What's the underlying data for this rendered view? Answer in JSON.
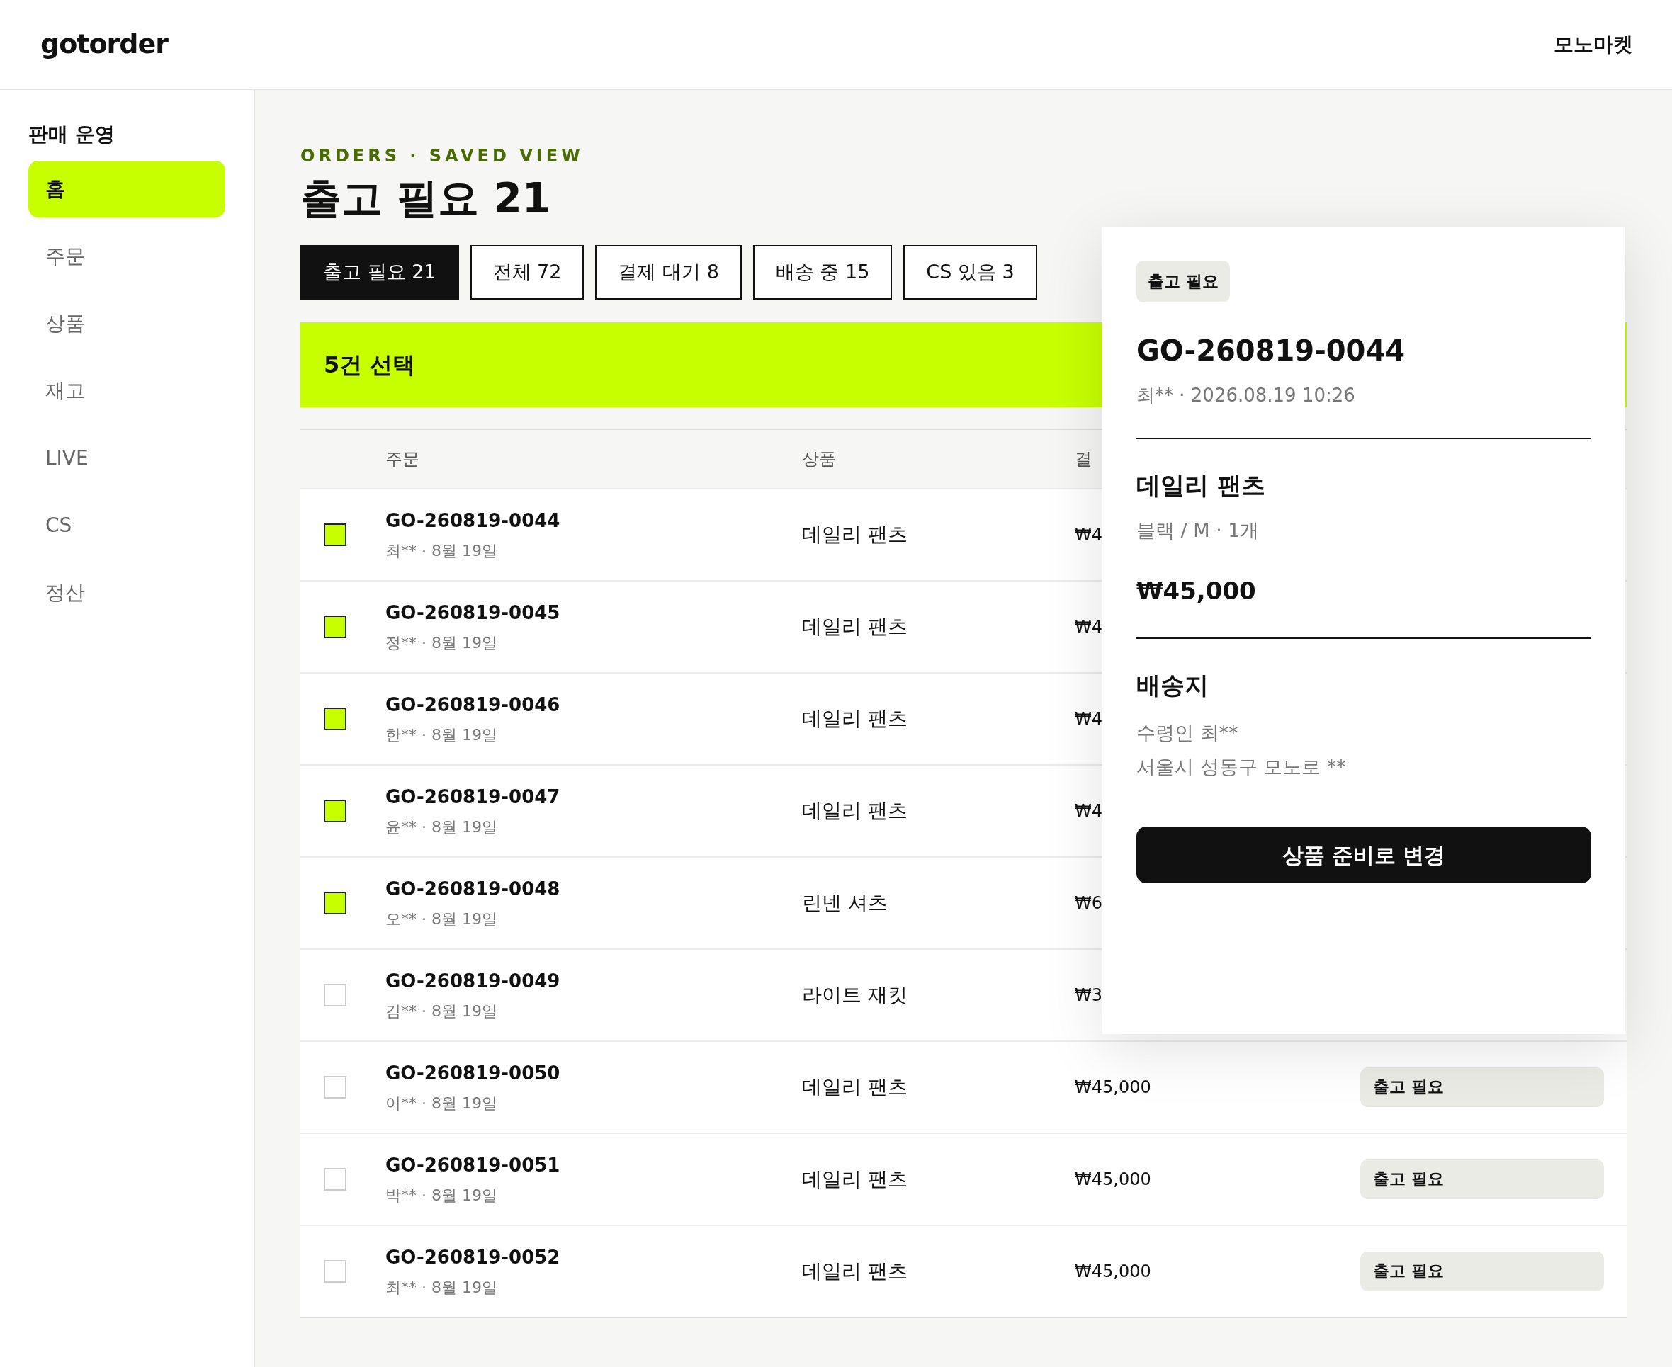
{
  "header": {
    "logo": "gotorder",
    "store": "모노마켓"
  },
  "sidebar": {
    "title": "판매 운영",
    "items": [
      {
        "label": "홈",
        "selected": true
      },
      {
        "label": "주문",
        "selected": false
      },
      {
        "label": "상품",
        "selected": false
      },
      {
        "label": "재고",
        "selected": false
      },
      {
        "label": "LIVE",
        "selected": false
      },
      {
        "label": "CS",
        "selected": false
      },
      {
        "label": "정산",
        "selected": false
      }
    ]
  },
  "eyebrow": "ORDERS · SAVED VIEW",
  "title": "출고 필요 21",
  "tabs": [
    {
      "label": "출고 필요 21",
      "selected": true
    },
    {
      "label": "전체 72",
      "selected": false
    },
    {
      "label": "결제 대기 8",
      "selected": false
    },
    {
      "label": "배송 중 15",
      "selected": false
    },
    {
      "label": "CS 있음 3",
      "selected": false
    }
  ],
  "selection_bar": {
    "text": "5건 선택"
  },
  "table": {
    "columns": [
      "주문",
      "상품",
      "결"
    ],
    "rows": [
      {
        "checked": true,
        "order": "GO-260819-0044",
        "meta": "최** · 8월 19일",
        "product": "데일리 팬츠",
        "price": "₩4"
      },
      {
        "checked": true,
        "order": "GO-260819-0045",
        "meta": "정** · 8월 19일",
        "product": "데일리 팬츠",
        "price": "₩4"
      },
      {
        "checked": true,
        "order": "GO-260819-0046",
        "meta": "한** · 8월 19일",
        "product": "데일리 팬츠",
        "price": "₩4"
      },
      {
        "checked": true,
        "order": "GO-260819-0047",
        "meta": "윤** · 8월 19일",
        "product": "데일리 팬츠",
        "price": "₩4"
      },
      {
        "checked": true,
        "order": "GO-260819-0048",
        "meta": "오** · 8월 19일",
        "product": "린넨 셔츠",
        "price": "₩6"
      },
      {
        "checked": false,
        "order": "GO-260819-0049",
        "meta": "김** · 8월 19일",
        "product": "라이트 재킷",
        "price": "₩3"
      },
      {
        "checked": false,
        "order": "GO-260819-0050",
        "meta": "이** · 8월 19일",
        "product": "데일리 팬츠",
        "price": "₩45,000",
        "status": "출고 필요"
      },
      {
        "checked": false,
        "order": "GO-260819-0051",
        "meta": "박** · 8월 19일",
        "product": "데일리 팬츠",
        "price": "₩45,000",
        "status": "출고 필요"
      },
      {
        "checked": false,
        "order": "GO-260819-0052",
        "meta": "최** · 8월 19일",
        "product": "데일리 팬츠",
        "price": "₩45,000",
        "status": "출고 필요"
      }
    ]
  },
  "detail_panel": {
    "status": "출고 필요",
    "order": "GO-260819-0044",
    "meta": "최** · 2026.08.19 10:26",
    "product": "데일리 팬츠",
    "options": "블랙 / M · 1개",
    "price": "₩45,000",
    "shipping_title": "배송지",
    "recipient": "수령인 최**",
    "address": "서울시 성동구 모노로 **",
    "action": "상품 준비로 변경"
  }
}
